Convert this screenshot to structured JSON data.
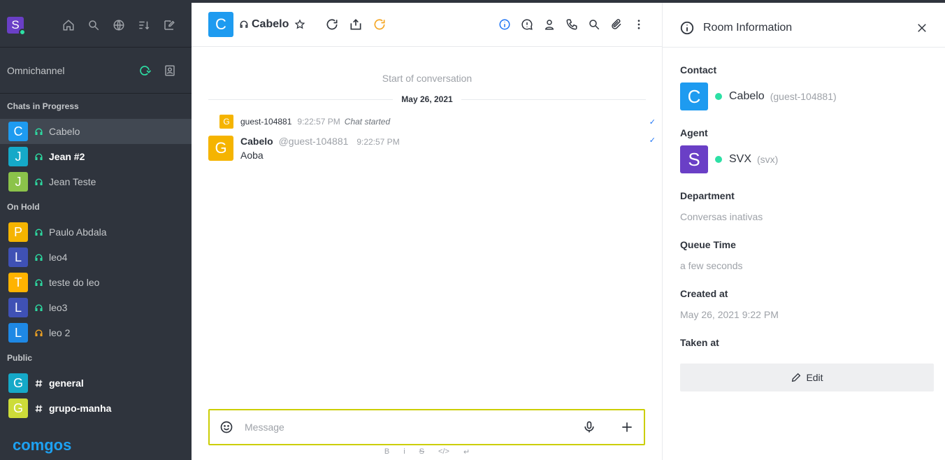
{
  "sidebar": {
    "user_initial": "S",
    "section_header": "Omnichannel",
    "groups": [
      {
        "title": "Chats in Progress",
        "rooms": [
          {
            "initial": "C",
            "name": "Cabelo",
            "color": "#1e9bf0",
            "active": true,
            "bold": false,
            "status_color": "#2de0a5"
          },
          {
            "initial": "J",
            "name": "Jean #2",
            "color": "#15a9c8",
            "active": false,
            "bold": true,
            "status_color": "#2de0a5"
          },
          {
            "initial": "J",
            "name": "Jean Teste",
            "color": "#8bc34a",
            "active": false,
            "bold": false,
            "status_color": "#2de0a5"
          }
        ]
      },
      {
        "title": "On Hold",
        "rooms": [
          {
            "initial": "P",
            "name": "Paulo Abdala",
            "color": "#f5b400",
            "active": false,
            "bold": false,
            "status_color": "#2de0a5"
          },
          {
            "initial": "L",
            "name": "leo4",
            "color": "#3f51b5",
            "active": false,
            "bold": false,
            "status_color": "#2de0a5"
          },
          {
            "initial": "T",
            "name": "teste do leo",
            "color": "#ffb300",
            "active": false,
            "bold": false,
            "status_color": "#2de0a5"
          },
          {
            "initial": "L",
            "name": "leo3",
            "color": "#3f51b5",
            "active": false,
            "bold": false,
            "status_color": "#2de0a5"
          },
          {
            "initial": "L",
            "name": "leo 2",
            "color": "#1e88e5",
            "active": false,
            "bold": false,
            "status_color": "#f5a623"
          }
        ]
      },
      {
        "title": "Public",
        "rooms": [
          {
            "initial": "G",
            "name": "general",
            "color": "#15a9c8",
            "active": false,
            "bold": true,
            "type": "channel"
          },
          {
            "initial": "G",
            "name": "grupo-manha",
            "color": "#cddc39",
            "active": false,
            "bold": true,
            "type": "channel"
          }
        ]
      }
    ],
    "brand": "comgos"
  },
  "main": {
    "room_initial": "C",
    "room_title": "Cabelo",
    "start_text": "Start of conversation",
    "date": "May 26, 2021",
    "system_message": {
      "initial": "G",
      "user": "guest-104881",
      "time": "9:22:57 PM",
      "text": "Chat started"
    },
    "message": {
      "initial": "G",
      "author": "Cabelo",
      "handle": "@guest-104881",
      "time": "9:22:57 PM",
      "body": "Aoba"
    },
    "composer_placeholder": "Message",
    "format": {
      "bold": "B",
      "italic": "i",
      "strike": "S",
      "code": "</>",
      "enter": "↵"
    }
  },
  "info": {
    "title": "Room Information",
    "contact_label": "Contact",
    "contact": {
      "initial": "C",
      "name": "Cabelo",
      "username": "(guest-104881)",
      "color": "#1e9bf0"
    },
    "agent_label": "Agent",
    "agent": {
      "initial": "S",
      "name": "SVX",
      "username": "(svx)",
      "color": "#6a3fc6"
    },
    "department_label": "Department",
    "department": "Conversas inativas",
    "queue_label": "Queue Time",
    "queue": "a few seconds",
    "created_label": "Created at",
    "created": "May 26, 2021 9:22 PM",
    "taken_label": "Taken at",
    "edit_label": "Edit"
  }
}
